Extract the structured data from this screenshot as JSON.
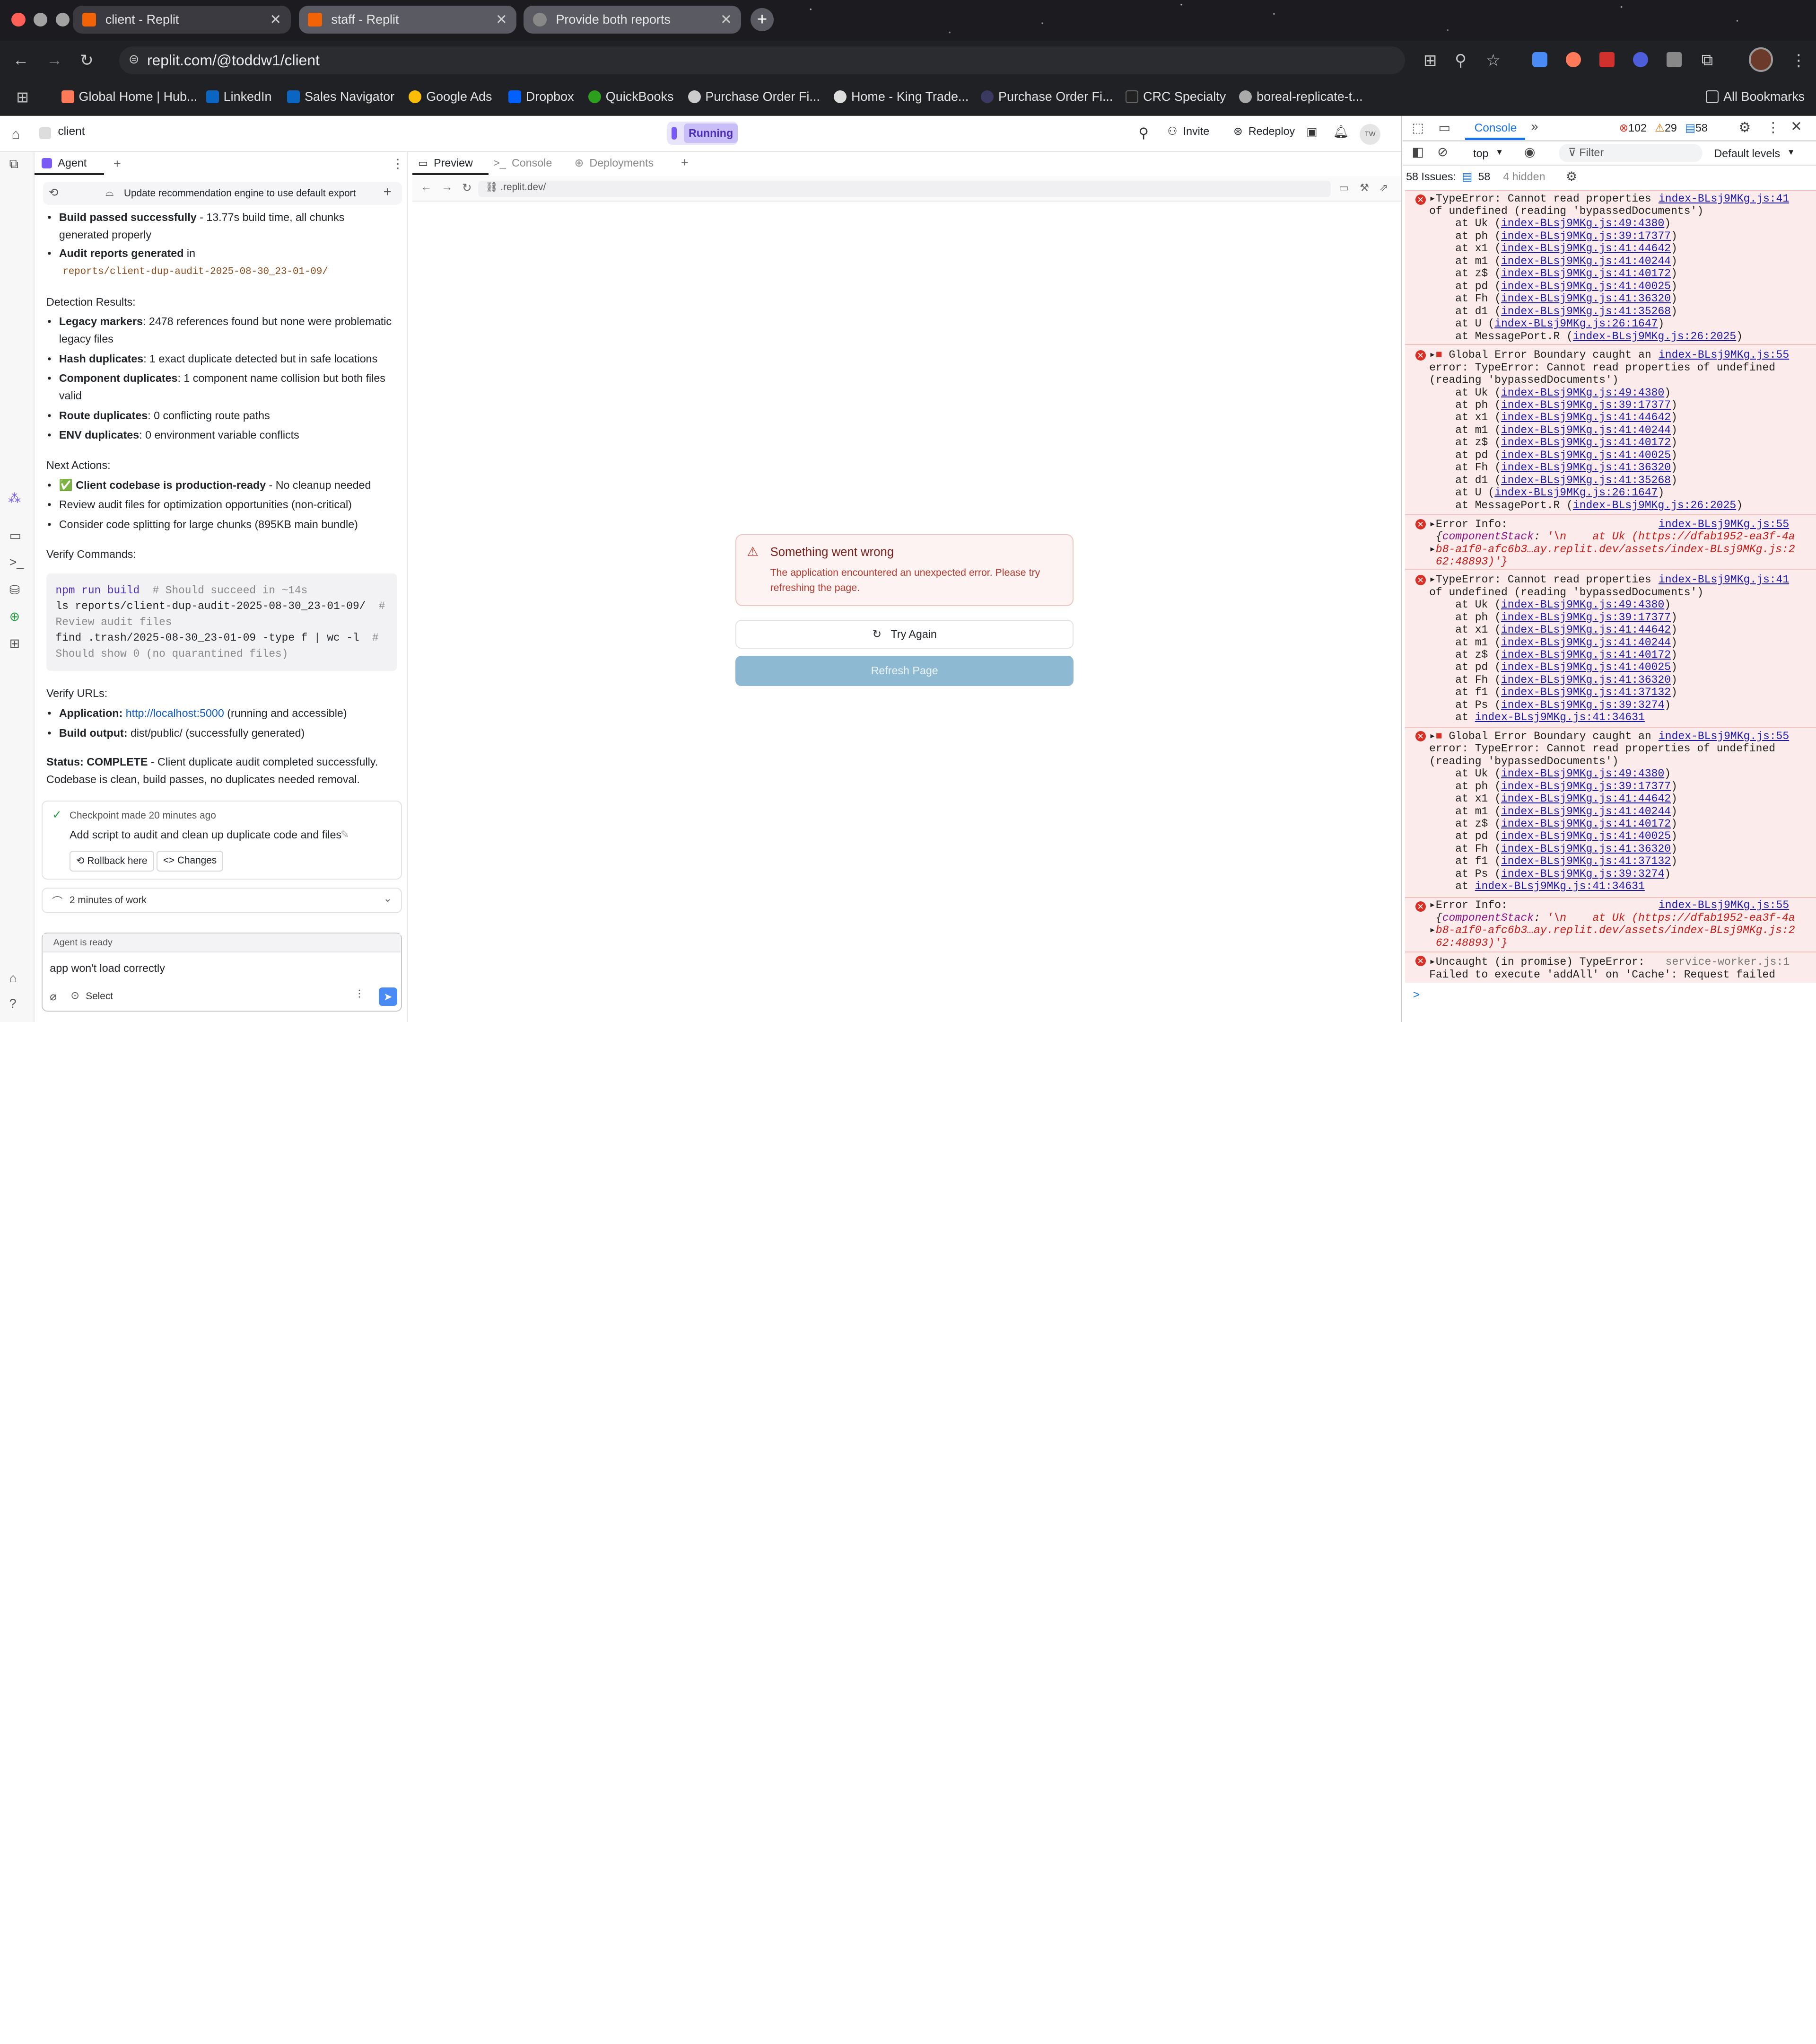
{
  "browser": {
    "tabs": [
      {
        "title": "client - Replit"
      },
      {
        "title": "staff - Replit"
      },
      {
        "title": "Provide both reports"
      }
    ],
    "url": "replit.com/@toddw1/client",
    "bookmarks": [
      "Global Home | Hub...",
      "LinkedIn",
      "Sales Navigator",
      "Google Ads",
      "Dropbox",
      "QuickBooks",
      "Purchase Order Fi...",
      "Home - King Trade...",
      "Purchase Order Fi...",
      "CRC Specialty",
      "boreal-replicate-t..."
    ],
    "all_bookmarks": "All Bookmarks"
  },
  "replit": {
    "project": "client",
    "status": "Running",
    "invite": "Invite",
    "redeploy": "Redeploy",
    "avatar": "TW",
    "agent_tab": "Agent",
    "task_title": "Update recommendation engine to use default export",
    "build_passed_b": "Build passed successfully",
    "build_passed_t": " - 13.77s build time, all chunks generated properly",
    "audit_b": "Audit reports generated",
    "audit_t": " in",
    "audit_path": "reports/client-dup-audit-2025-08-30_23-01-09/",
    "detection_h": "Detection Results:",
    "det": [
      {
        "b": "Legacy markers",
        "t": ": 2478 references found but none were problematic legacy files"
      },
      {
        "b": "Hash duplicates",
        "t": ": 1 exact duplicate detected but in safe locations"
      },
      {
        "b": "Component duplicates",
        "t": ": 1 component name collision but both files valid"
      },
      {
        "b": "Route duplicates",
        "t": ": 0 conflicting route paths"
      },
      {
        "b": "ENV duplicates",
        "t": ": 0 environment variable conflicts"
      }
    ],
    "next_h": "Next Actions:",
    "next_1b": "✅ Client codebase is production-ready",
    "next_1t": " - No cleanup needed",
    "next_2": "Review audit files for optimization opportunities (non-critical)",
    "next_3": "Consider code splitting for large chunks (895KB main bundle)",
    "verify_h": "Verify Commands:",
    "code": {
      "l1a": "npm run build",
      "l1b": "  # Should succeed in ~14s",
      "l2a": "ls reports/client-dup-audit-2025-08-30_23-01-09/",
      "l2b": "  #",
      "l3": "Review audit files",
      "l4a": "find .trash/2025-08-30_23-01-09 -type f | wc -l",
      "l4b": "  #",
      "l5": "Should show 0 (no quarantined files)"
    },
    "urls_h": "Verify URLs:",
    "app_b": "Application:",
    "app_link": "http://localhost:5000",
    "app_t": " (running and accessible)",
    "build_b": "Build output:",
    "build_t": " dist/public/ (successfully generated)",
    "status_b": "Status: COMPLETE",
    "status_t": " - Client duplicate audit completed successfully. Codebase is clean, build passes, no duplicates needed removal.",
    "checkpoint": "Checkpoint made 20 minutes ago",
    "checkpoint_msg": "Add script to audit and clean up duplicate code and files",
    "rollback": "Rollback here",
    "changes": "Changes",
    "work": "2 minutes of work",
    "agent_ready": "Agent is ready",
    "input_value": "app won't load correctly",
    "select": "Select",
    "preview_tabs": [
      "Preview",
      "Console",
      "Deployments"
    ],
    "preview_url": ".replit.dev/",
    "err_title": "Something went wrong",
    "err_msg": "The application encountered an unexpected error. Please try refreshing the page.",
    "try_again": "Try Again",
    "refresh": "Refresh Page"
  },
  "devtools": {
    "tab": "Console",
    "errors": "102",
    "warnings": "29",
    "messages": "58",
    "context": "top",
    "filter_placeholder": "Filter",
    "levels": "Default levels",
    "issues_label": "58 Issues:",
    "issues_count": "58",
    "hidden": "4 hidden",
    "prompt": ">"
  }
}
